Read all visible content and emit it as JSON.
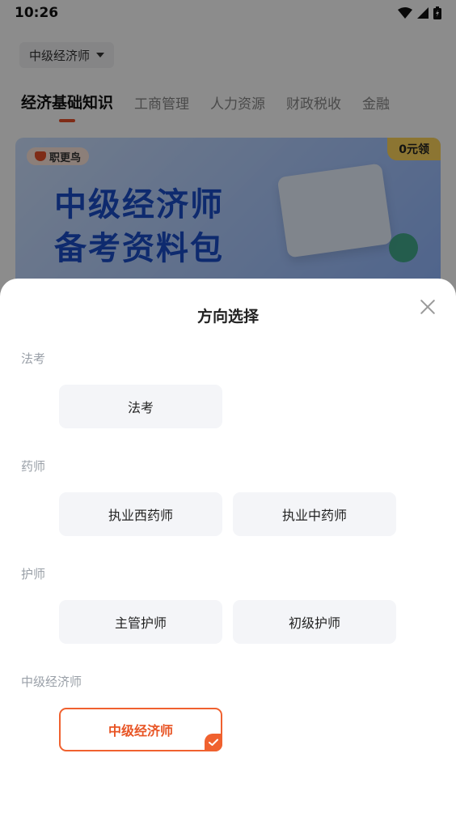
{
  "status_bar": {
    "time": "10:26"
  },
  "header": {
    "direction_label": "中级经济师"
  },
  "subject_tabs": [
    {
      "label": "经济基础知识"
    },
    {
      "label": "工商管理"
    },
    {
      "label": "人力资源"
    },
    {
      "label": "财政税收"
    },
    {
      "label": "金融"
    }
  ],
  "banner": {
    "brand": "职更鸟",
    "badge": "0元领",
    "title_line1": "中级经济师",
    "title_line2": "备考资料包"
  },
  "sheet": {
    "title": "方向选择",
    "groups": [
      {
        "label": "法考",
        "options": [
          "法考"
        ]
      },
      {
        "label": "药师",
        "options": [
          "执业西药师",
          "执业中药师"
        ]
      },
      {
        "label": "护师",
        "options": [
          "主管护师",
          "初级护师"
        ]
      },
      {
        "label": "中级经济师",
        "options": [
          "中级经济师"
        ]
      }
    ],
    "selected_option": "中级经济师"
  },
  "colors": {
    "accent": "#f0612f",
    "option_bg": "#f4f5f8",
    "label_gray": "#9aa0a8"
  }
}
